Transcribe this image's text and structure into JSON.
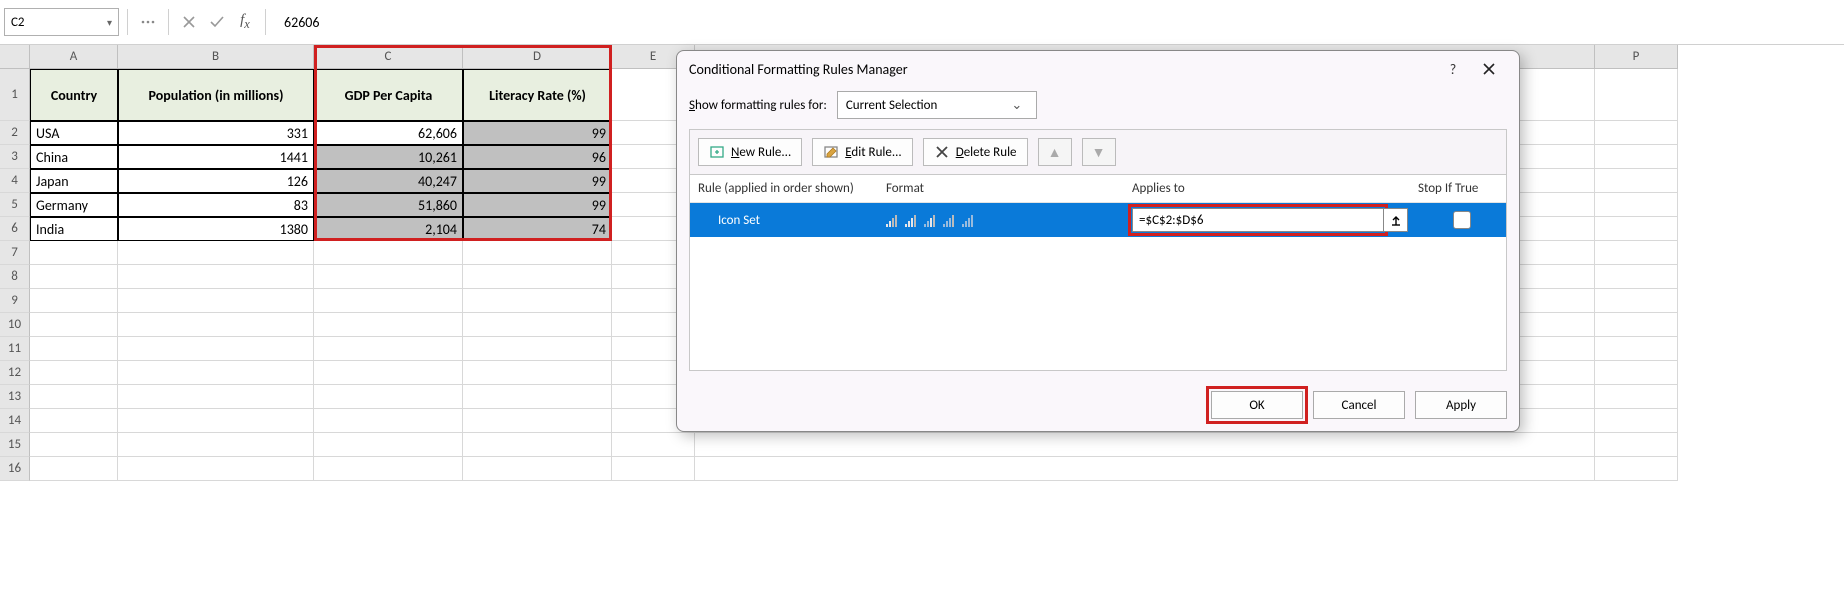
{
  "formula_bar": {
    "name_box": "C2",
    "formula": "62606"
  },
  "columns": [
    "A",
    "B",
    "C",
    "D",
    "E",
    "P"
  ],
  "rows": [
    1,
    2,
    3,
    4,
    5,
    6,
    7,
    8,
    9,
    10,
    11,
    12,
    13,
    14,
    15,
    16
  ],
  "headers": {
    "A": "Country",
    "B": "Population (in millions)",
    "C": "GDP Per Capita",
    "D": "Literacy Rate (%)"
  },
  "data": [
    {
      "A": "USA",
      "B": "331",
      "C": "62,606",
      "D": "99"
    },
    {
      "A": "China",
      "B": "1441",
      "C": "10,261",
      "D": "96"
    },
    {
      "A": "Japan",
      "B": "126",
      "C": "40,247",
      "D": "99"
    },
    {
      "A": "Germany",
      "B": "83",
      "C": "51,860",
      "D": "99"
    },
    {
      "A": "India",
      "B": "1380",
      "C": "2,104",
      "D": "74"
    }
  ],
  "dialog": {
    "title": "Conditional Formatting Rules Manager",
    "show_label": "Show formatting rules for:",
    "show_value": "Current Selection",
    "toolbar": {
      "new": "New Rule...",
      "edit": "Edit Rule...",
      "delete": "Delete Rule"
    },
    "col_headers": {
      "rule": "Rule (applied in order shown)",
      "format": "Format",
      "applies": "Applies to",
      "stop": "Stop If True"
    },
    "rule": {
      "name": "Icon Set",
      "applies_to": "=$C$2:$D$6"
    },
    "buttons": {
      "ok": "OK",
      "cancel": "Cancel",
      "apply": "Apply"
    }
  }
}
